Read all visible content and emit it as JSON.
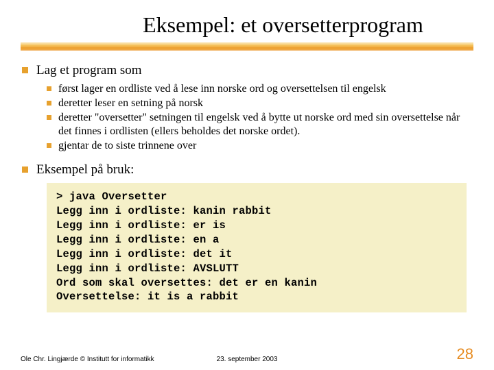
{
  "title": "Eksempel: et oversetterprogram",
  "bullets": {
    "top": "Lag et program som",
    "subs": [
      "først lager en ordliste ved å lese inn norske ord og oversettelsen til engelsk",
      "deretter leser en setning på norsk",
      "deretter \"oversetter\" setningen til engelsk ved å bytte ut norske ord med sin oversettelse når det finnes i ordlisten (ellers beholdes det norske ordet).",
      "gjentar de to siste trinnene over"
    ],
    "usage": "Eksempel på bruk:"
  },
  "code": "> java Oversetter\nLegg inn i ordliste: kanin rabbit\nLegg inn i ordliste: er is\nLegg inn i ordliste: en a\nLegg inn i ordliste: det it\nLegg inn i ordliste: AVSLUTT\nOrd som skal oversettes: det er en kanin\nOversettelse: it is a rabbit",
  "footer": {
    "left": "Ole Chr. Lingjærde © Institutt for informatikk",
    "date": "23. september 2003",
    "page": "28"
  }
}
